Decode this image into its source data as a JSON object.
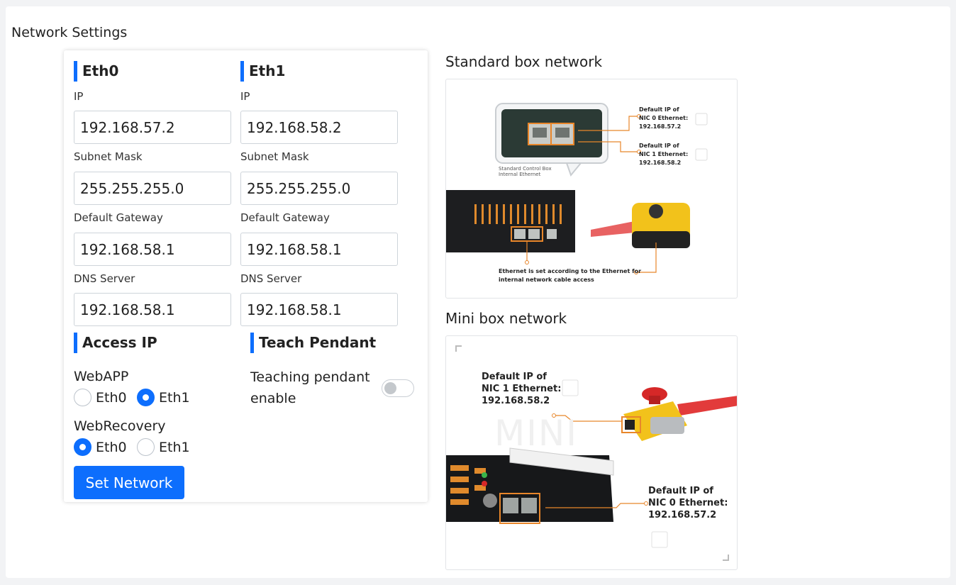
{
  "page": {
    "title": "Network Settings"
  },
  "eth0": {
    "heading": "Eth0",
    "ip_label": "IP",
    "ip": "192.168.57.2",
    "mask_label": "Subnet Mask",
    "mask": "255.255.255.0",
    "gateway_label": "Default Gateway",
    "gateway": "192.168.58.1",
    "dns_label": "DNS Server",
    "dns": "192.168.58.1"
  },
  "eth1": {
    "heading": "Eth1",
    "ip_label": "IP",
    "ip": "192.168.58.2",
    "mask_label": "Subnet Mask",
    "mask": "255.255.255.0",
    "gateway_label": "Default Gateway",
    "gateway": "192.168.58.1",
    "dns_label": "DNS Server",
    "dns": "192.168.58.1"
  },
  "access_ip": {
    "heading": "Access IP",
    "webapp": {
      "label": "WebAPP",
      "options": [
        "Eth0",
        "Eth1"
      ],
      "selected": "Eth1"
    },
    "webrecovery": {
      "label": "WebRecovery",
      "options": [
        "Eth0",
        "Eth1"
      ],
      "selected": "Eth0"
    }
  },
  "teach_pendant": {
    "heading": "Teach Pendant",
    "label_line1": "Teaching pendant",
    "label_line2": "enable",
    "enabled": false
  },
  "actions": {
    "set_network": "Set Network"
  },
  "standard_box": {
    "title": "Standard box network",
    "callout_box": "Standard Control Box",
    "callout_internal": "Internal Ethernet",
    "nic0_line1": "Default IP of",
    "nic0_line2": "NIC 0 Ethernet:",
    "nic0_ip": "192.168.57.2",
    "nic1_line1": "Default IP of",
    "nic1_line2": "NIC 1 Ethernet:",
    "nic1_ip": "192.168.58.2",
    "note_line1": "Ethernet is set according to the Ethernet for",
    "note_line2": "internal network cable access"
  },
  "mini_box": {
    "title": "Mini box network",
    "watermark": "MINI",
    "nic1_line1": "Default IP of",
    "nic1_line2": "NIC 1 Ethernet:",
    "nic1_ip": "192.168.58.2",
    "nic0_line1": "Default IP of",
    "nic0_line2": "NIC 0 Ethernet:",
    "nic0_ip": "192.168.57.2"
  },
  "colors": {
    "accent": "#0d6efd",
    "callout_orange": "#e8862a",
    "pendant_yellow": "#f2c21b",
    "cable_red": "#e23b3b"
  }
}
